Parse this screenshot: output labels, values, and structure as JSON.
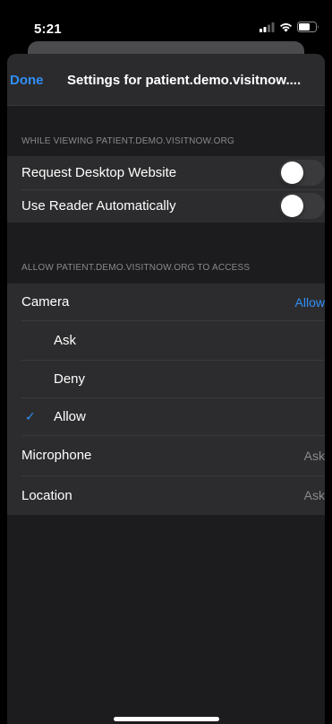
{
  "status_bar": {
    "time": "5:21"
  },
  "nav": {
    "done_label": "Done",
    "title": "Settings for patient.demo.visitnow...."
  },
  "section_viewing": {
    "header": "WHILE VIEWING PATIENT.DEMO.VISITNOW.ORG",
    "rows": [
      {
        "label": "Request Desktop Website",
        "on": false
      },
      {
        "label": "Use Reader Automatically",
        "on": false
      }
    ]
  },
  "section_access": {
    "header": "ALLOW PATIENT.DEMO.VISITNOW.ORG TO ACCESS",
    "camera": {
      "label": "Camera",
      "value": "Allow"
    },
    "camera_options": [
      {
        "label": "Ask",
        "selected": false
      },
      {
        "label": "Deny",
        "selected": false
      },
      {
        "label": "Allow",
        "selected": true
      }
    ],
    "check_glyph": "✓",
    "microphone": {
      "label": "Microphone",
      "value": "Ask"
    },
    "location": {
      "label": "Location",
      "value": "Ask"
    }
  },
  "colors": {
    "accent": "#2f8ff5",
    "sheet": "#1c1c1e",
    "cell": "#2c2c2e",
    "secondary_text": "#8a8a8e"
  }
}
